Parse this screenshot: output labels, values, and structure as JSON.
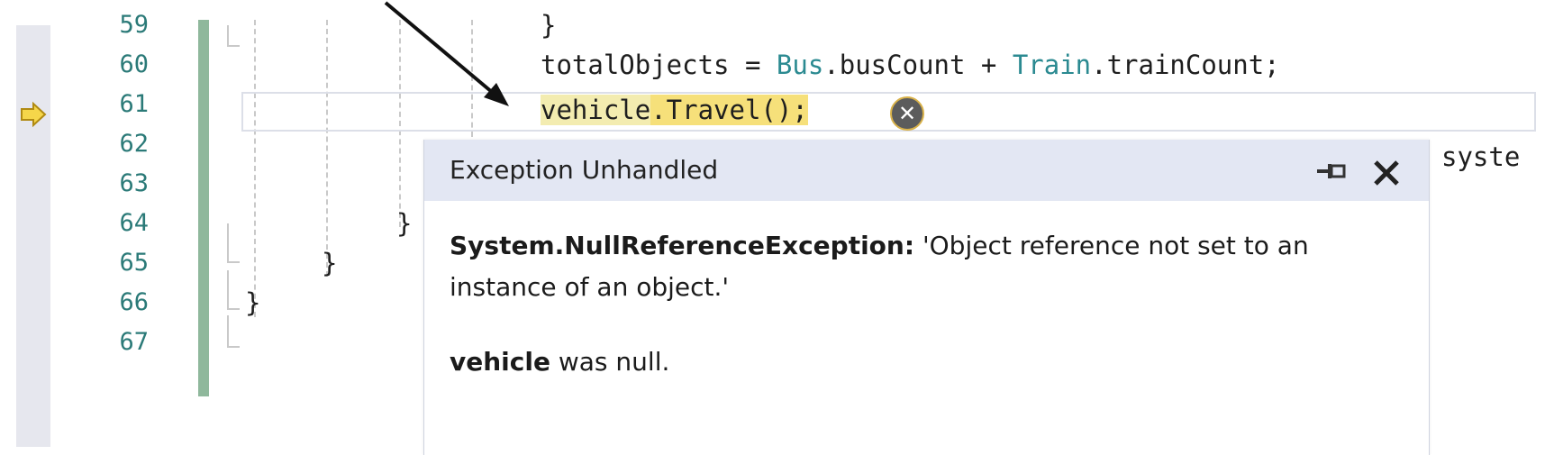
{
  "gutter": {
    "line_numbers": [
      "59",
      "60",
      "61",
      "62",
      "63",
      "64",
      "65",
      "66",
      "67"
    ]
  },
  "code": {
    "line59": "}",
    "line60_var": "totalObjects = ",
    "line60_type1": "Bus",
    "line60_mid": ".busCount + ",
    "line60_type2": "Train",
    "line60_end": ".trainCount;",
    "line61_a": "vehicle",
    "line61_b": ".Travel();",
    "line62_cut": "syste",
    "line64": "}",
    "line65": "}",
    "line66": "}"
  },
  "exception_popup": {
    "title": "Exception Unhandled",
    "exception_type": "System.NullReferenceException:",
    "message": " 'Object reference not set to an instance of an object.'",
    "detail_var": "vehicle",
    "detail_text": " was null."
  },
  "icons": {
    "execution_pointer": "yellow-arrow-icon",
    "error": "error-x-circle-icon",
    "pin": "pin-icon",
    "close": "close-icon"
  },
  "colors": {
    "line_number": "#2b7a78",
    "type_name": "#2b8a91",
    "highlight": "#f6e07a",
    "popup_header": "#e3e7f3"
  }
}
